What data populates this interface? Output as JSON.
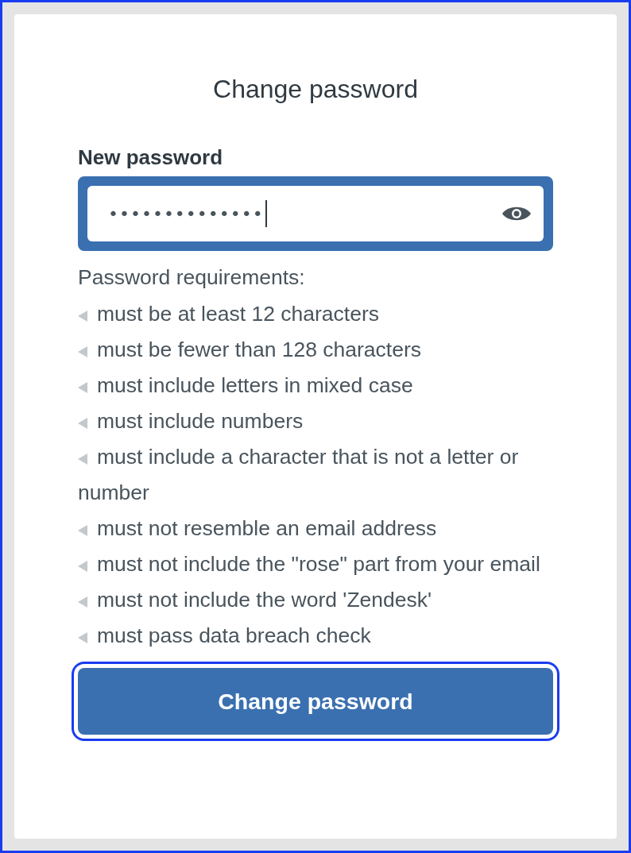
{
  "title": "Change password",
  "password_field": {
    "label": "New password",
    "value": "••••••••••••••",
    "focused": true
  },
  "requirements": {
    "heading": "Password requirements:",
    "items": [
      "must be at least 12 characters",
      "must be fewer than 128 characters",
      "must include letters in mixed case",
      "must include numbers",
      "must include a character that is not a letter or number",
      "must not resemble an email address",
      "must not include the \"rose\" part from your email",
      "must not include the word 'Zendesk'",
      "must pass data breach check"
    ]
  },
  "submit_button": "Change password"
}
